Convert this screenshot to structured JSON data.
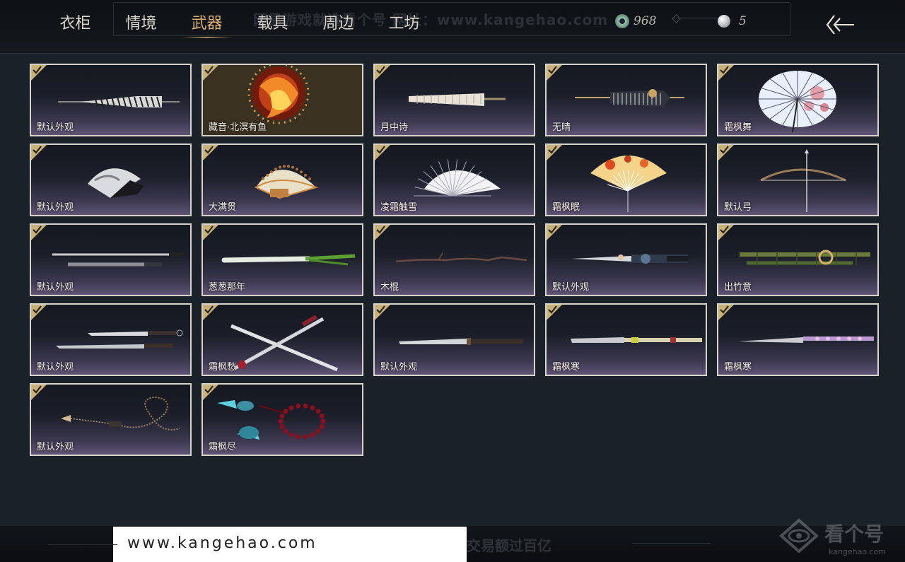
{
  "tabs": [
    {
      "label": "衣柜",
      "active": false
    },
    {
      "label": "情境",
      "active": false
    },
    {
      "label": "武器",
      "active": true
    },
    {
      "label": "载具",
      "active": false
    },
    {
      "label": "周边",
      "active": false
    },
    {
      "label": "工坊",
      "active": false
    }
  ],
  "currency": {
    "jade": {
      "value": "968",
      "icon": "jade-coin-icon"
    },
    "pearl": {
      "value": "5",
      "icon": "pearl-icon"
    }
  },
  "watermark": {
    "top": "网易游戏就选看个号  网址：www.kangehao.com",
    "url": "www.kangehao.com",
    "bottom": "看个号专业网易游戏八年  年交易额过百亿",
    "logo_main": "看个号",
    "logo_sub": "kangehao.com"
  },
  "colors": {
    "accent": "#d7ae74",
    "check_corner": "#c9b27a",
    "card_border": "#d6d3cc"
  },
  "weapons": [
    {
      "label": "默认外观",
      "kind": "umbrella-closed",
      "owned": true
    },
    {
      "label": "藏音·北溟有鱼",
      "kind": "phoenix",
      "owned": true
    },
    {
      "label": "月中诗",
      "kind": "umbrella-closed-light",
      "owned": true
    },
    {
      "label": "无晴",
      "kind": "umbrella-closed-dark",
      "owned": true
    },
    {
      "label": "霜枫舞",
      "kind": "umbrella-open",
      "owned": true
    },
    {
      "label": "默认外观",
      "kind": "fan",
      "owned": true
    },
    {
      "label": "大满贯",
      "kind": "fan-gold",
      "owned": true
    },
    {
      "label": "凌霜触雪",
      "kind": "fan-white",
      "owned": true
    },
    {
      "label": "霜枫眠",
      "kind": "fan-maple",
      "owned": true
    },
    {
      "label": "默认弓",
      "kind": "bow",
      "owned": true
    },
    {
      "label": "默认外观",
      "kind": "twin-swords-sheathed",
      "owned": true
    },
    {
      "label": "葱葱那年",
      "kind": "scallion",
      "owned": true
    },
    {
      "label": "木棍",
      "kind": "stick",
      "owned": true
    },
    {
      "label": "默认外观",
      "kind": "ornate-sword",
      "owned": true
    },
    {
      "label": "出竹意",
      "kind": "bamboo",
      "owned": true
    },
    {
      "label": "默认外观",
      "kind": "twin-blades",
      "owned": true
    },
    {
      "label": "霜枫愁",
      "kind": "crossed-blades",
      "owned": true
    },
    {
      "label": "默认外观",
      "kind": "long-blade",
      "owned": true
    },
    {
      "label": "霜枫寒",
      "kind": "spear-blade",
      "owned": true
    },
    {
      "label": "霜枫寒",
      "kind": "spear-blade-pink",
      "owned": true
    },
    {
      "label": "默认外观",
      "kind": "rope-dart",
      "owned": true
    },
    {
      "label": "霜枫尽",
      "kind": "beaded-darts",
      "owned": true
    }
  ]
}
